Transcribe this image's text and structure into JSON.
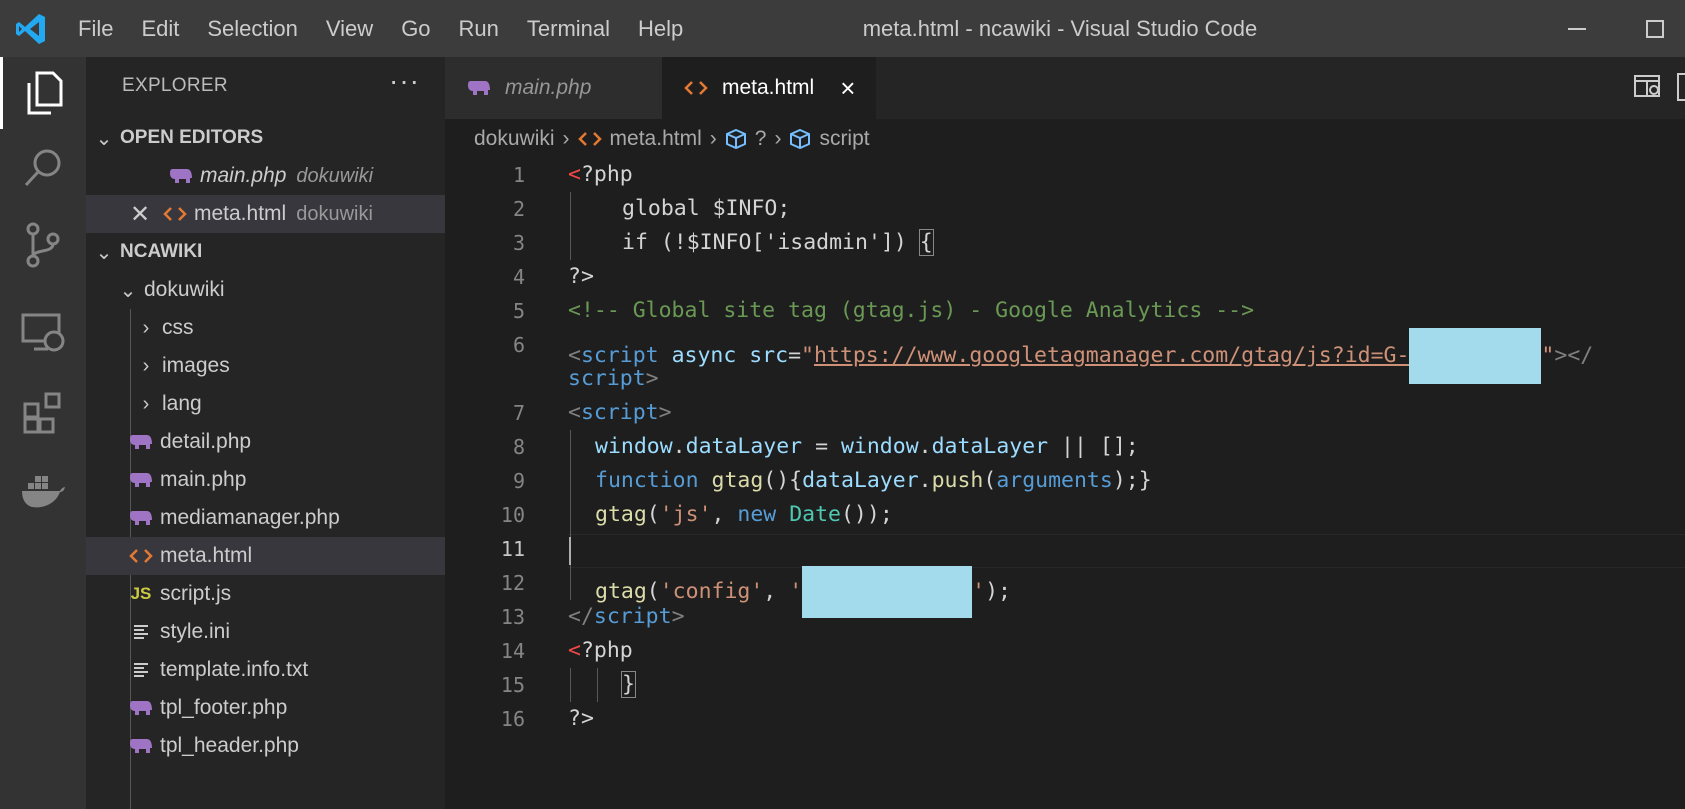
{
  "titlebar": {
    "menu": [
      "File",
      "Edit",
      "Selection",
      "View",
      "Go",
      "Run",
      "Terminal",
      "Help"
    ],
    "window_title": "meta.html - ncawiki - Visual Studio Code"
  },
  "activity_bar": [
    "explorer-icon",
    "search-icon",
    "source-control-icon",
    "remote-explorer-icon",
    "extensions-icon",
    "docker-icon"
  ],
  "sidebar": {
    "header": "EXPLORER",
    "more": "···",
    "open_editors": {
      "title": "OPEN EDITORS",
      "items": [
        {
          "name": "main.php",
          "folder": "dokuwiki"
        },
        {
          "name": "meta.html",
          "folder": "dokuwiki"
        }
      ]
    },
    "workspace": {
      "title": "NCAWIKI",
      "folder": "dokuwiki",
      "items": [
        "css",
        "images",
        "lang",
        "detail.php",
        "main.php",
        "mediamanager.php",
        "meta.html",
        "script.js",
        "style.ini",
        "template.info.txt",
        "tpl_footer.php",
        "tpl_header.php"
      ]
    }
  },
  "tabs": [
    {
      "label": "main.php",
      "active": false
    },
    {
      "label": "meta.html",
      "active": true,
      "close": "×"
    }
  ],
  "breadcrumb": [
    "dokuwiki",
    "meta.html",
    "?",
    "script"
  ],
  "editor": {
    "line_numbers": [
      "1",
      "2",
      "3",
      "4",
      "5",
      "6",
      "7",
      "8",
      "9",
      "10",
      "11",
      "12",
      "13",
      "14",
      "15",
      "16"
    ],
    "current_line": "11",
    "code": {
      "l1_a": "<",
      "l1_b": "?php",
      "l2": "global $INFO;",
      "l3_a": "if (!$INFO['isadmin']) ",
      "l3_b": "{",
      "l4": "?>",
      "l5": "<!-- Global site tag (gtag.js) - Google Analytics -->",
      "l6_a": "<",
      "l6_b": "script",
      "l6_c": " async",
      "l6_d": " src",
      "l6_e": "=",
      "l6_f": "\"",
      "l6_url": "https://www.googletagmanager.com/gtag/js?id=G-",
      "l6_g": "\"",
      "l6_h": "></",
      "l6b_a": "script",
      "l6b_b": ">",
      "l7_a": "<",
      "l7_b": "script",
      "l7_c": ">",
      "l8_a": "window",
      "l8_b": ".",
      "l8_c": "dataLayer",
      "l8_d": " = ",
      "l8_e": "window",
      "l8_f": ".",
      "l8_g": "dataLayer",
      "l8_h": " || [];",
      "l9_a": "function",
      "l9_b": " gtag",
      "l9_c": "(){",
      "l9_d": "dataLayer",
      "l9_e": ".",
      "l9_f": "push",
      "l9_g": "(",
      "l9_h": "arguments",
      "l9_i": ");}",
      "l10_a": "gtag",
      "l10_b": "(",
      "l10_c": "'js'",
      "l10_d": ", ",
      "l10_e": "new",
      "l10_f": " Date",
      "l10_g": "());",
      "l12_a": "gtag",
      "l12_b": "(",
      "l12_c": "'config'",
      "l12_d": ", ",
      "l12_e": "'",
      "l12_f": "'",
      "l12_g": ");",
      "l13_a": "</",
      "l13_b": "script",
      "l13_c": ">",
      "l14_a": "<",
      "l14_b": "?php",
      "l15": "}",
      "l16": "?>"
    }
  },
  "colors": {
    "titlebar": "#3c3c3c",
    "activity_bar": "#333333",
    "sidebar": "#252526",
    "editor": "#1e1e1e",
    "redaction": "#a3dbec"
  }
}
